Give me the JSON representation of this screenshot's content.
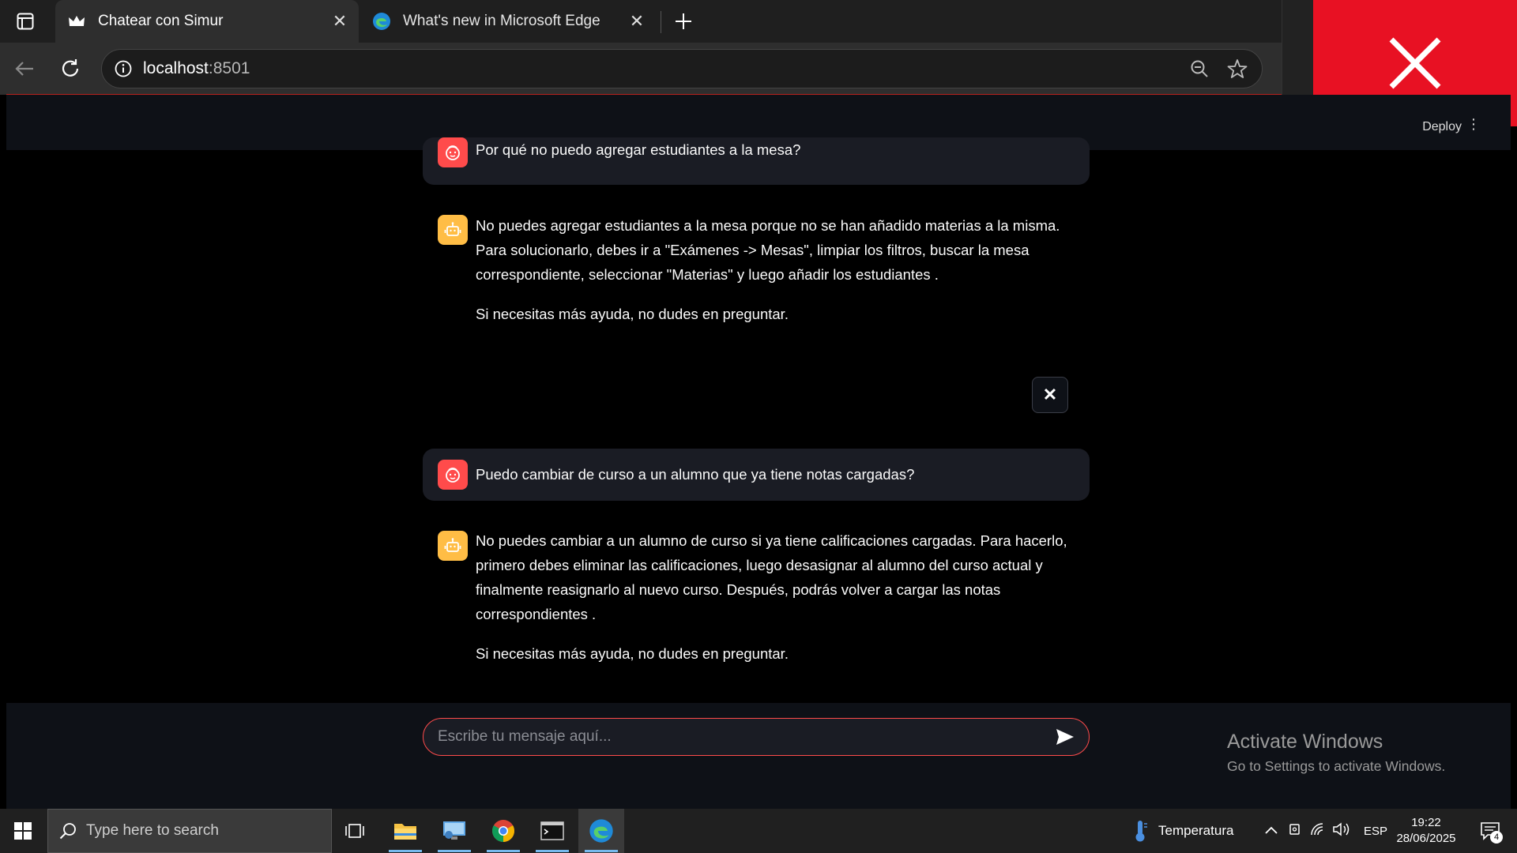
{
  "browser": {
    "tabs": [
      {
        "title": "Chatear con Simur",
        "active": true,
        "favicon": "crown-icon"
      },
      {
        "title": "What's new in Microsoft Edge",
        "active": false,
        "favicon": "edge-icon"
      }
    ],
    "address": {
      "host": "localhost",
      "port": ":8501"
    }
  },
  "app": {
    "deploy_label": "Deploy",
    "messages": [
      {
        "role": "user",
        "paragraphs": [
          "Por qué no puedo agregar estudiantes a la mesa?"
        ]
      },
      {
        "role": "assistant",
        "paragraphs": [
          "No puedes agregar estudiantes a la mesa porque no se han añadido materias a la misma. Para solucionarlo, debes ir a \"Exámenes -> Mesas\", limpiar los filtros, buscar la mesa correspondiente, seleccionar \"Materias\" y luego añadir los estudiantes .",
          "Si necesitas más ayuda, no dudes en preguntar."
        ]
      },
      {
        "role": "user",
        "paragraphs": [
          "Puedo cambiar de curso a un alumno que ya tiene notas cargadas?"
        ]
      },
      {
        "role": "assistant",
        "paragraphs": [
          "No puedes cambiar a un alumno de curso si ya tiene calificaciones cargadas. Para hacerlo, primero debes eliminar las calificaciones, luego desasignar al alumno del curso actual y finalmente reasignarlo al nuevo curso. Después, podrás volver a cargar las notas correspondientes .",
          "Si necesitas más ayuda, no dudes en preguntar."
        ]
      }
    ],
    "dismiss_label": "✕",
    "input": {
      "placeholder": "Escribe tu mensaje aquí...",
      "value": ""
    }
  },
  "watermark": {
    "line1": "Activate Windows",
    "line2": "Go to Settings to activate Windows."
  },
  "taskbar": {
    "search_placeholder": "Type here to search",
    "weather_label": "Temperatura",
    "language": "ESP",
    "time": "19:22",
    "date": "28/06/2025",
    "notification_count": "4"
  },
  "colors": {
    "accent": "#ff4b4b",
    "assistant_avatar": "#ffbd45",
    "overlay_close": "#e81123"
  }
}
